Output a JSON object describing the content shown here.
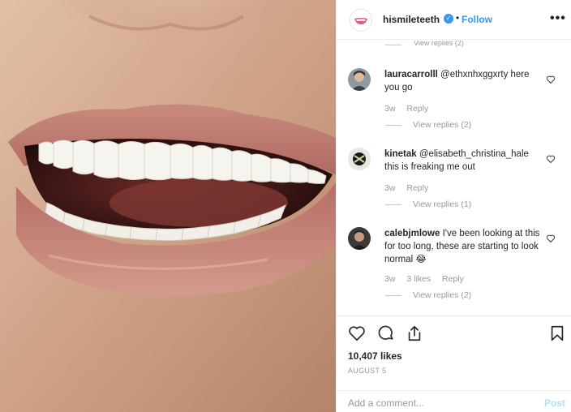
{
  "post": {
    "username": "hismileteeth",
    "separator": "•",
    "follow_label": "Follow",
    "more_label": "•••",
    "image_alt": "close-up of smiling mouth with white teeth"
  },
  "comments": {
    "partial_replies": "View replies (2)",
    "items": [
      {
        "username": "lauracarrolll",
        "text": "@ethxnhxggxrty here you go",
        "time": "3w",
        "likes": "",
        "reply_label": "Reply",
        "replies": "View replies (2)"
      },
      {
        "username": "kinetak",
        "text": "@elisabeth_christina_hale this is freaking me out",
        "time": "3w",
        "likes": "",
        "reply_label": "Reply",
        "replies": "View replies (1)"
      },
      {
        "username": "calebjmlowe",
        "text": "I've been looking at this for too long, these are starting to look normal 😂",
        "time": "3w",
        "likes": "3 likes",
        "reply_label": "Reply",
        "replies": "View replies (2)"
      }
    ]
  },
  "actions": {
    "like_icon": "heart-icon",
    "comment_icon": "comment-bubble-icon",
    "share_icon": "share-icon",
    "save_icon": "bookmark-icon",
    "likes_count": "10,407 likes",
    "date": "AUGUST 5"
  },
  "add_comment": {
    "placeholder": "Add a comment...",
    "post_label": "Post"
  },
  "colors": {
    "link_blue": "#3897f0",
    "muted_gray": "#999999",
    "post_disabled": "#b2dffc",
    "border": "#efefef"
  }
}
